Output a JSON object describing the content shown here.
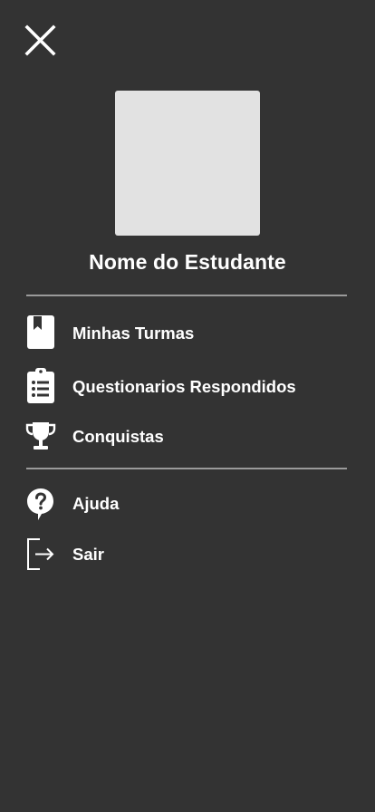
{
  "drawer": {
    "student_name": "Nome do Estudante",
    "menu": [
      {
        "label": "Minhas Turmas",
        "icon": "bookmark-book-icon"
      },
      {
        "label": "Questionarios Respondidos",
        "icon": "clipboard-list-icon"
      },
      {
        "label": "Conquistas",
        "icon": "trophy-icon"
      }
    ],
    "secondary_menu": [
      {
        "label": "Ajuda",
        "icon": "help-bubble-icon"
      },
      {
        "label": "Sair",
        "icon": "logout-icon"
      }
    ]
  },
  "colors": {
    "background": "#333333",
    "avatar_placeholder": "#e2e2e2",
    "text": "#ffffff",
    "divider": "#9a9a9a"
  }
}
